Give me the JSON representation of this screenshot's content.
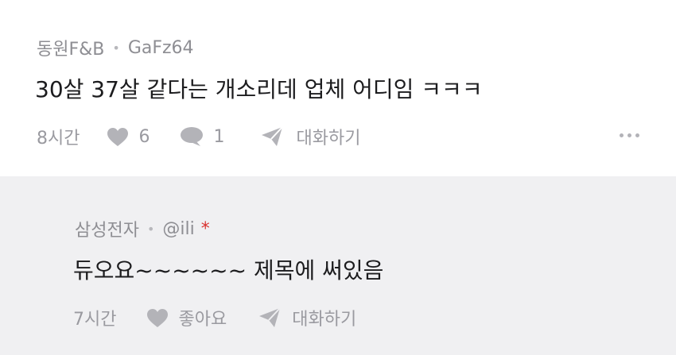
{
  "comment": {
    "author_org": "동원F&B",
    "author_name": "GaFz64",
    "text": "30살 37살 같다는 개소리데 업체 어디임 ㅋㅋㅋ",
    "time": "8시간",
    "likes": "6",
    "replies": "1",
    "reply_label": "대화하기"
  },
  "reply": {
    "author_org": "삼성전자",
    "author_name": "@ili",
    "author_mark": "*",
    "text": "듀오요~~~~~~ 제목에 써있음",
    "time": "7시간",
    "like_label": "좋아요",
    "reply_label": "대화하기"
  },
  "colors": {
    "reply_background": "#f0f0f2",
    "muted_text": "#8e8e93",
    "icon": "#b3b3b8",
    "asterisk": "#d9322f"
  },
  "icons": [
    "heart-icon",
    "speech-bubble-icon",
    "paper-plane-icon",
    "more-dots-icon"
  ]
}
